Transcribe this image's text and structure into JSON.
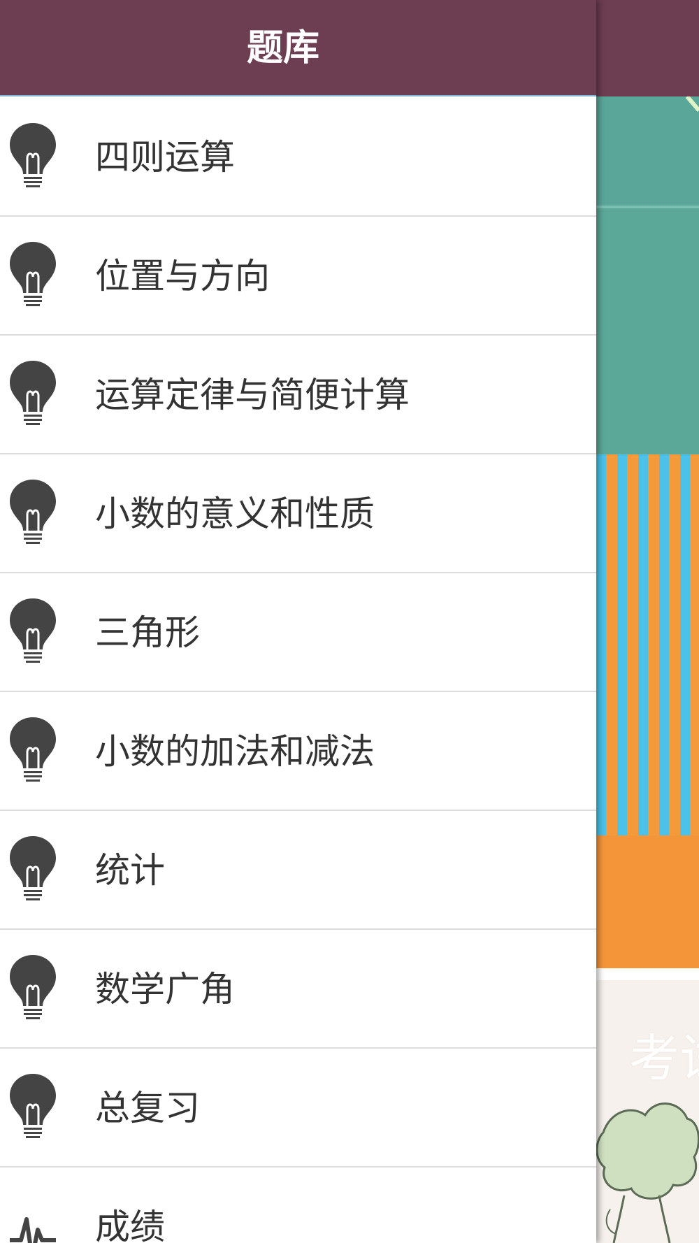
{
  "header": {
    "title": "题库"
  },
  "menu": {
    "icon": "hamburger-menu-icon"
  },
  "colors": {
    "header_bg": "#6d3d51",
    "text": "#333333",
    "icon": "#444444"
  },
  "list": {
    "items": [
      {
        "label": "四则运算",
        "icon": "lightbulb-icon"
      },
      {
        "label": "位置与方向",
        "icon": "lightbulb-icon"
      },
      {
        "label": "运算定律与简便计算",
        "icon": "lightbulb-icon"
      },
      {
        "label": "小数的意义和性质",
        "icon": "lightbulb-icon"
      },
      {
        "label": "三角形",
        "icon": "lightbulb-icon"
      },
      {
        "label": "小数的加法和减法",
        "icon": "lightbulb-icon"
      },
      {
        "label": "统计",
        "icon": "lightbulb-icon"
      },
      {
        "label": "数学广角",
        "icon": "lightbulb-icon"
      },
      {
        "label": "总复习",
        "icon": "lightbulb-icon"
      },
      {
        "label": "成绩",
        "icon": "pulse-chart-icon"
      }
    ]
  },
  "background": {
    "cover_text": "考试"
  }
}
